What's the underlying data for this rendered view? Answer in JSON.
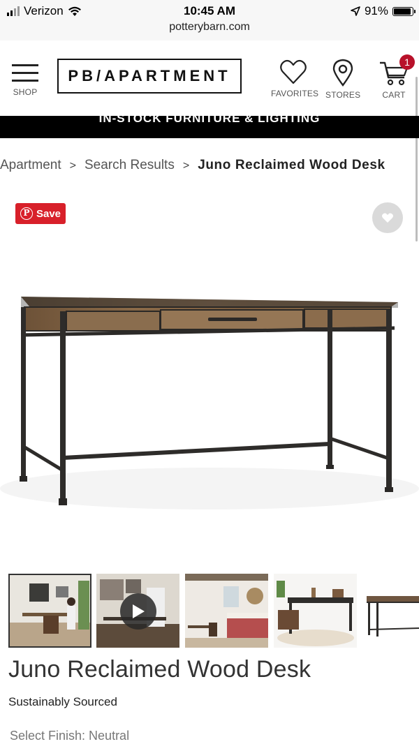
{
  "status_bar": {
    "carrier": "Verizon",
    "time": "10:45 AM",
    "battery_percent": "91%",
    "battery_level": 0.91,
    "url": "potterybarn.com"
  },
  "header": {
    "shop_label": "SHOP",
    "logo_text": "PB/APARTMENT",
    "favorites_label": "FAVORITES",
    "stores_label": "STORES",
    "cart_label": "CART",
    "cart_count": "1"
  },
  "banner": {
    "text": "IN-STOCK FURNITURE & LIGHTING"
  },
  "breadcrumb": {
    "items": [
      "Apartment",
      "Search Results",
      "Juno Reclaimed Wood Desk"
    ],
    "separator": ">"
  },
  "actions": {
    "save_label": "Save",
    "pinterest_glyph": "P"
  },
  "thumbnails": [
    {
      "name": "thumb-office-scene",
      "selected": true
    },
    {
      "name": "thumb-video",
      "video": true
    },
    {
      "name": "thumb-bedroom-scene"
    },
    {
      "name": "thumb-desk-rug"
    },
    {
      "name": "thumb-desk-side"
    }
  ],
  "product": {
    "title": "Juno Reclaimed Wood Desk",
    "tag": "Sustainably Sourced",
    "finish": "Select Finish: Neutral"
  },
  "colors": {
    "accent_red": "#d8202a",
    "badge_red": "#b8112a",
    "banner_bg": "#000000"
  }
}
